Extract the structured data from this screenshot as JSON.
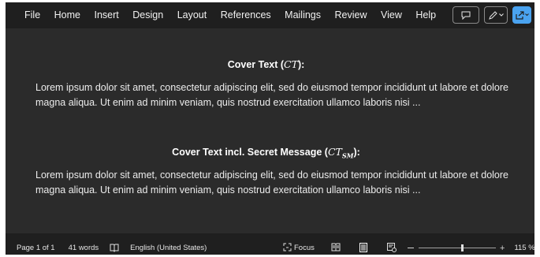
{
  "menu": [
    "File",
    "Home",
    "Insert",
    "Design",
    "Layout",
    "References",
    "Mailings",
    "Review",
    "View",
    "Help"
  ],
  "ribbon_icons": {
    "comments": "comment-icon",
    "editing": "pen-icon",
    "share": "share-icon"
  },
  "colors": {
    "window_bg": "#1f1f1f",
    "document_bg": "#2b2b2b",
    "share_accent": "#4aa3f0",
    "text": "#ffffff"
  },
  "document": {
    "heading1": {
      "text": "Cover Text (",
      "math": "CT",
      "suffix": "):"
    },
    "paragraph1": "Lorem ipsum dolor sit amet, consectetur adipiscing elit, sed do eiusmod tempor incididunt ut labore et dolore magna aliqua. Ut enim ad minim veniam, quis nostrud exercitation ullamco laboris nisi ...",
    "heading2": {
      "text": "Cover Text incl. Secret Message (",
      "math": "CT",
      "math_sub": "SM",
      "suffix": "):"
    },
    "paragraph2": "Lorem  ipsum dolor sit amet, consectetur adipiscing elit, sed do eiusmod tempor incididunt ut labore et dolore magna aliqua. Ut enim ad  minim veniam, quis nostrud exercitation ullamco laboris nisi ..."
  },
  "status": {
    "page": "Page 1 of 1",
    "words": "41 words",
    "language": "English (United States)",
    "focus": "Focus",
    "zoom_percent": "115 %",
    "zoom_slider_fraction": 0.57
  }
}
